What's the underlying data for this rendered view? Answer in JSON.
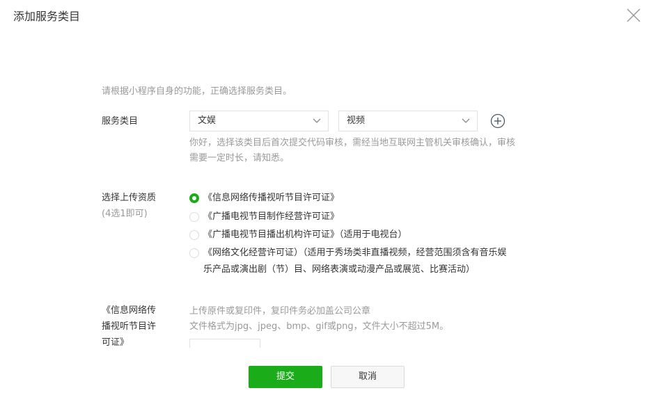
{
  "dialog": {
    "title": "添加服务类目"
  },
  "intro": "请根据小程序自身的功能，正确选择服务类目。",
  "service_category": {
    "label": "服务类目",
    "primary_value": "文娱",
    "secondary_value": "视频",
    "hint_line1": "你好，选择该类目后首次提交代码审核，需经当地互联网主管机关审核确认，审核",
    "hint_line2": "需要一定时长，请知悉。"
  },
  "qualification": {
    "label": "选择上传资质",
    "sublabel": "(4选1即可)",
    "options": [
      {
        "text": "《信息网络传播视听节目许可证》",
        "checked": true
      },
      {
        "text": "《广播电视节目制作经营许可证》",
        "checked": false
      },
      {
        "text": "《广播电视节目播出机构许可证》（适用于电视台）",
        "checked": false
      },
      {
        "text_line1": "《网络文化经营许可证）（适用于秀场类非直播视频，经营范围须含有音乐娱",
        "text_line2": "乐产品或演出剧（节）目、网络表演或动漫产品或展览、比赛活动）",
        "checked": false
      }
    ]
  },
  "upload": {
    "label_line1": "《信息网络传",
    "label_line2": "播视听节目许",
    "label_line3": "可证》",
    "hint_line1": "上传原件或复印件，复印件务必加盖公司公章",
    "hint_line2": "文件格式为jpg、jpeg、bmp、gif或png，文件大小不超过5M。"
  },
  "buttons": {
    "submit": "提交",
    "cancel": "取消"
  },
  "colors": {
    "accent": "#1aad19"
  }
}
